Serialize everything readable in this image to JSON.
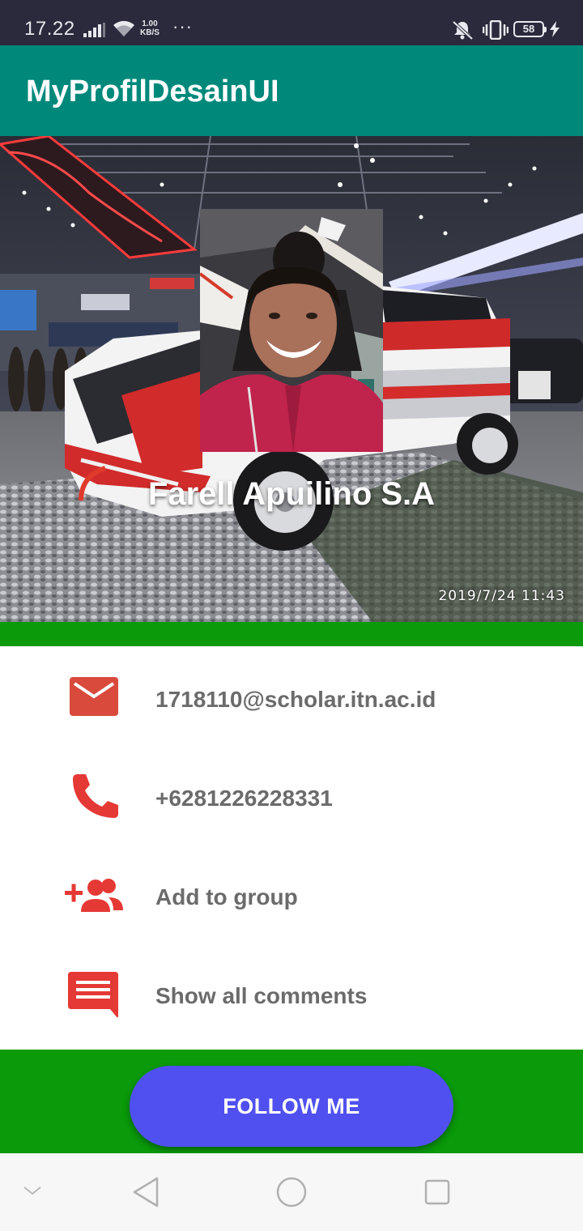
{
  "status_bar": {
    "time": "17.22",
    "net_speed_value": "1.00",
    "net_speed_unit": "KB/S",
    "more": "···",
    "battery_level": "58"
  },
  "app_bar": {
    "title": "MyProfilDesainUI"
  },
  "header": {
    "profile_name": "Farell Apuilino S.A",
    "photo_timestamp": "2019/7/24  11:43"
  },
  "contacts": [
    {
      "icon": "email-icon",
      "label": "1718110@scholar.itn.ac.id"
    },
    {
      "icon": "phone-icon",
      "label": "+6281226228331"
    },
    {
      "icon": "group-add-icon",
      "label": "Add to group"
    },
    {
      "icon": "comment-icon",
      "label": "Show all comments"
    }
  ],
  "follow_button": {
    "label": "FOLLOW ME"
  },
  "colors": {
    "app_bar": "#00897b",
    "green_band": "#0a9a0a",
    "follow_button": "#5050f0",
    "icon_red": "#e53935",
    "label_gray": "#6b6b6b"
  }
}
